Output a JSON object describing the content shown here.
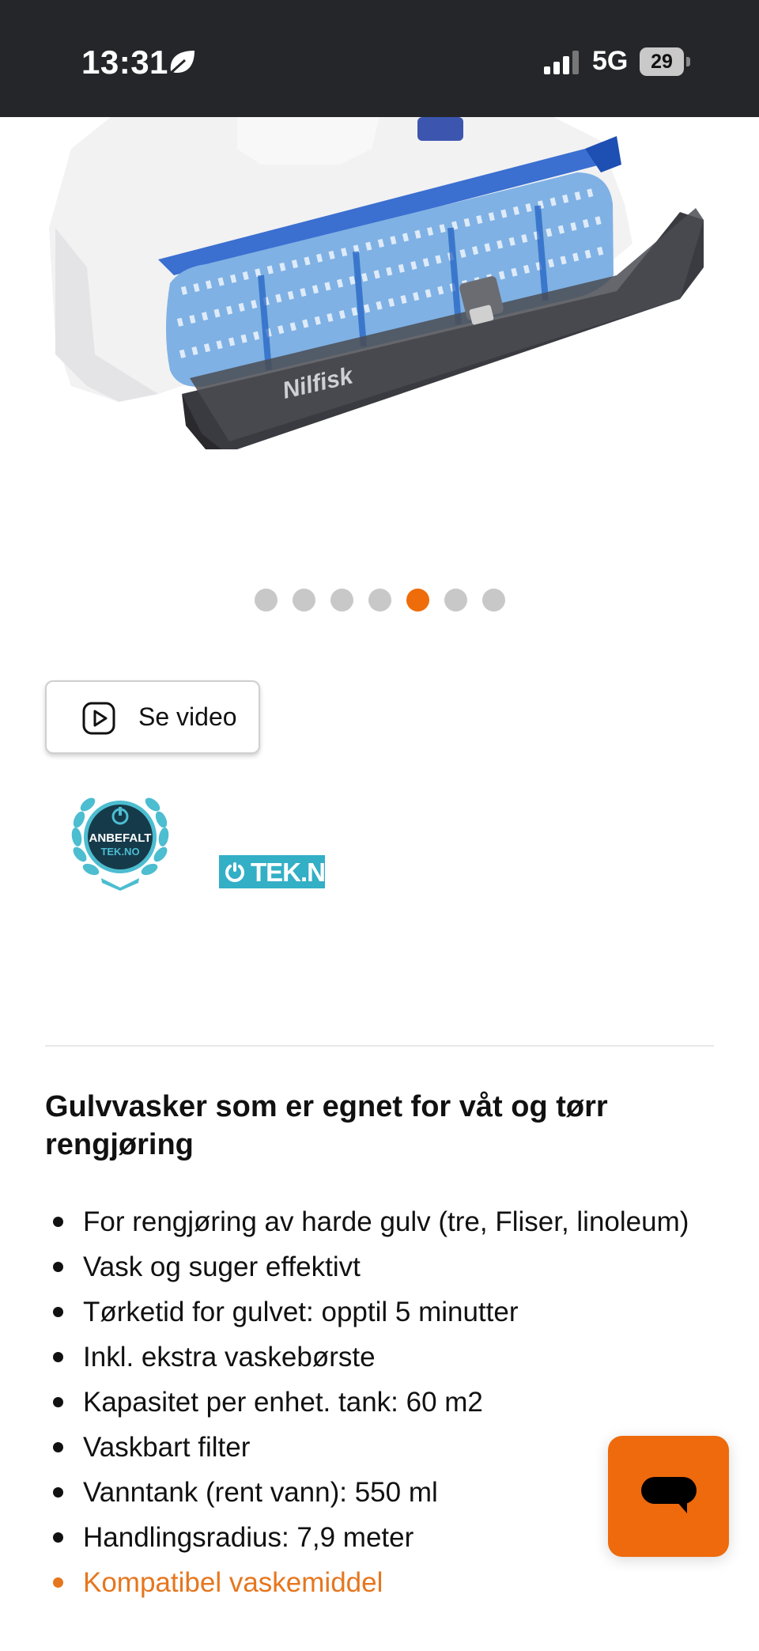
{
  "status_bar": {
    "time": "13:31",
    "network": "5G",
    "battery": "29"
  },
  "product_image": {
    "brand_mark": "Nilfisk"
  },
  "carousel": {
    "count": 7,
    "active_index": 4
  },
  "video_button": {
    "label": "Se video"
  },
  "badges": {
    "anbefalt_line1": "ANBEFALT",
    "anbefalt_line2": "TEK.NO",
    "tekno_label": "TEK.NO"
  },
  "description": {
    "title": "Gulvvasker som er egnet for våt og tørr rengjøring",
    "features": [
      "For rengjøring av harde gulv (tre, Fliser, linoleum)",
      "Vask og suger effektivt",
      "Tørketid for gulvet: opptil 5 minutter",
      "Inkl. ekstra vaskebørste",
      "Kapasitet per enhet. tank: 60 m2",
      "Vaskbart filter",
      "Vanntank (rent vann): 550 ml",
      "Handlingsradius: 7,9 meter",
      "Kompatibel vaskemiddel"
    ]
  },
  "colors": {
    "accent": "#ef6c0a",
    "status_bar": "#25262a",
    "tekno": "#33afc6",
    "link": "#e6761e"
  },
  "icons": {
    "leaf": "leaf-icon",
    "play": "play-icon",
    "chat": "chat-icon"
  }
}
